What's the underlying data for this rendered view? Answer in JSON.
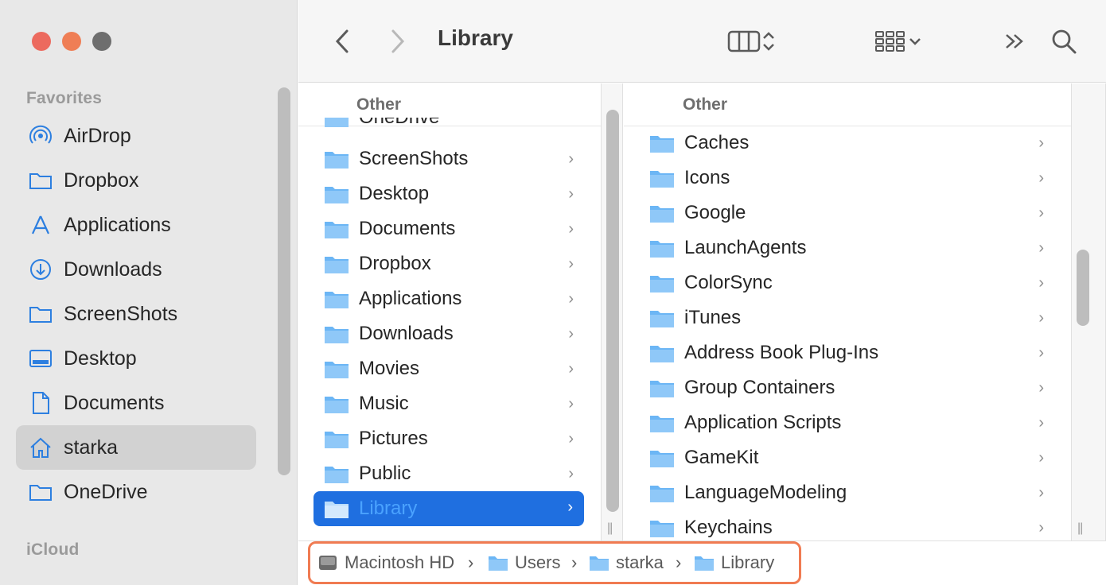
{
  "window": {
    "title": "Library"
  },
  "sidebar": {
    "favorites_heading": "Favorites",
    "icloud_heading": "iCloud",
    "items": [
      {
        "label": "AirDrop",
        "icon": "airdrop-icon"
      },
      {
        "label": "Dropbox",
        "icon": "folder-icon"
      },
      {
        "label": "Applications",
        "icon": "applications-icon"
      },
      {
        "label": "Downloads",
        "icon": "download-icon"
      },
      {
        "label": "ScreenShots",
        "icon": "folder-icon"
      },
      {
        "label": "Desktop",
        "icon": "desktop-icon"
      },
      {
        "label": "Documents",
        "icon": "document-icon"
      },
      {
        "label": "starka",
        "icon": "home-icon",
        "selected": true
      },
      {
        "label": "OneDrive",
        "icon": "folder-icon"
      }
    ]
  },
  "columns": [
    {
      "header": "Other",
      "partial_top": "OneDrive",
      "items": [
        "ScreenShots",
        "Desktop",
        "Documents",
        "Dropbox",
        "Applications",
        "Downloads",
        "Movies",
        "Music",
        "Pictures",
        "Public",
        "Library"
      ],
      "selected": "Library"
    },
    {
      "header": "Other",
      "items": [
        "Caches",
        "Icons",
        "Google",
        "LaunchAgents",
        "ColorSync",
        "iTunes",
        "Address Book Plug-Ins",
        "Group Containers",
        "Application Scripts",
        "GameKit",
        "LanguageModeling",
        "Keychains"
      ]
    }
  ],
  "pathbar": {
    "crumbs": [
      "Macintosh HD",
      "Users",
      "starka",
      "Library"
    ],
    "separator": "›",
    "highlight_color": "#f07b52"
  },
  "colors": {
    "accent": "#1f6fe0",
    "folder": "#6cb6f5"
  },
  "chevron": "›"
}
